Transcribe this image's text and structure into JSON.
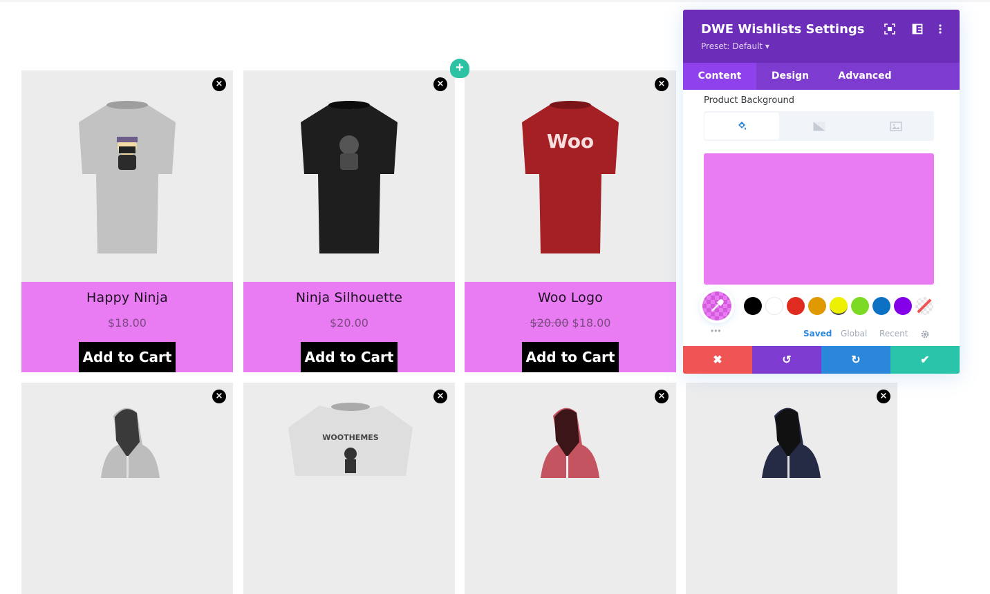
{
  "products_row1": [
    {
      "title": "Happy Ninja",
      "price": "$18.00",
      "old_price": "",
      "cart_label": "Add to Cart",
      "shirt_color": "#c2c2c2",
      "graphic": "ninja"
    },
    {
      "title": "Ninja Silhouette",
      "price": "$20.00",
      "old_price": "",
      "cart_label": "Add to Cart",
      "shirt_color": "#1e1e1e",
      "graphic": "silhouette"
    },
    {
      "title": "Woo Logo",
      "price": "$18.00",
      "old_price": "$20.00",
      "cart_label": "Add to Cart",
      "shirt_color": "#a52025",
      "graphic": "Woo"
    }
  ],
  "products_row2": [
    {
      "item": "hoodie",
      "color": "#bdbdbd"
    },
    {
      "item": "tshirt",
      "color": "#dedede",
      "graphic": "WOOTHEMES"
    },
    {
      "item": "hoodie",
      "color": "#c4545f"
    },
    {
      "item": "hoodie",
      "color": "#262b45"
    }
  ],
  "remove_icon": "×",
  "add_row_icon": "+",
  "panel": {
    "title": "DWE Wishlists Settings",
    "preset": "Preset: Default ▾",
    "header_icons": [
      "fullscreen-icon",
      "sidebar-layout-icon",
      "more-vertical-icon"
    ],
    "tabs": [
      "Content",
      "Design",
      "Advanced"
    ],
    "active_tab": "Content",
    "section_label": "Product Background",
    "bg_types": [
      "color",
      "gradient",
      "image"
    ],
    "current_color": "#ea7cf3",
    "swatches": [
      "#000000",
      "#ffffff",
      "#e02b20",
      "#e09900",
      "#edf000",
      "#7cda24",
      "#0c71c3",
      "#8300e9",
      "transparent"
    ],
    "dots": "•••",
    "palette_links": [
      "Saved",
      "Global",
      "Recent"
    ],
    "active_palette": "Saved",
    "footer": {
      "cancel": "✖",
      "undo": "↺",
      "redo": "↻",
      "save": "✔"
    },
    "colors": {
      "header": "#6c2eb9",
      "tabs": "#7e3bd0",
      "cancel": "#ef5555",
      "undo": "#7d3bcf",
      "redo": "#2b87da",
      "save": "#29c4a9"
    }
  }
}
